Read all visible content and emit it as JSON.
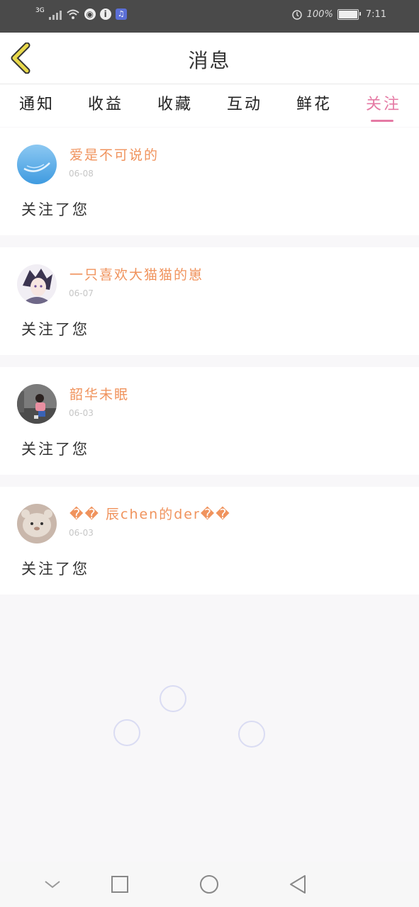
{
  "status_bar": {
    "network": "3G",
    "battery_percent": "100%",
    "time": "7:11"
  },
  "header": {
    "title": "消息"
  },
  "tabs": [
    {
      "label": "通知",
      "active": false
    },
    {
      "label": "收益",
      "active": false
    },
    {
      "label": "收藏",
      "active": false
    },
    {
      "label": "互动",
      "active": false
    },
    {
      "label": "鲜花",
      "active": false
    },
    {
      "label": "关注",
      "active": true
    }
  ],
  "notifications": [
    {
      "name": "爱是不可说的",
      "date": "06-08",
      "message": "关注了您",
      "avatar": "sky-blue-avatar"
    },
    {
      "name": "一只喜欢大猫猫的崽",
      "date": "06-07",
      "message": "关注了您",
      "avatar": "anime-character-avatar"
    },
    {
      "name": "韶华未眠",
      "date": "06-03",
      "message": "关注了您",
      "avatar": "person-photo-avatar"
    },
    {
      "name": "�� 辰chen的der��",
      "date": "06-03",
      "message": "关注了您",
      "avatar": "plush-toy-avatar"
    }
  ],
  "colors": {
    "accent": "#e57aa4",
    "name_color": "#f0935d",
    "back_icon": "#e8d84a"
  },
  "nav_bar": {
    "buttons": [
      "down-icon",
      "recents-icon",
      "home-icon",
      "back-icon"
    ]
  }
}
